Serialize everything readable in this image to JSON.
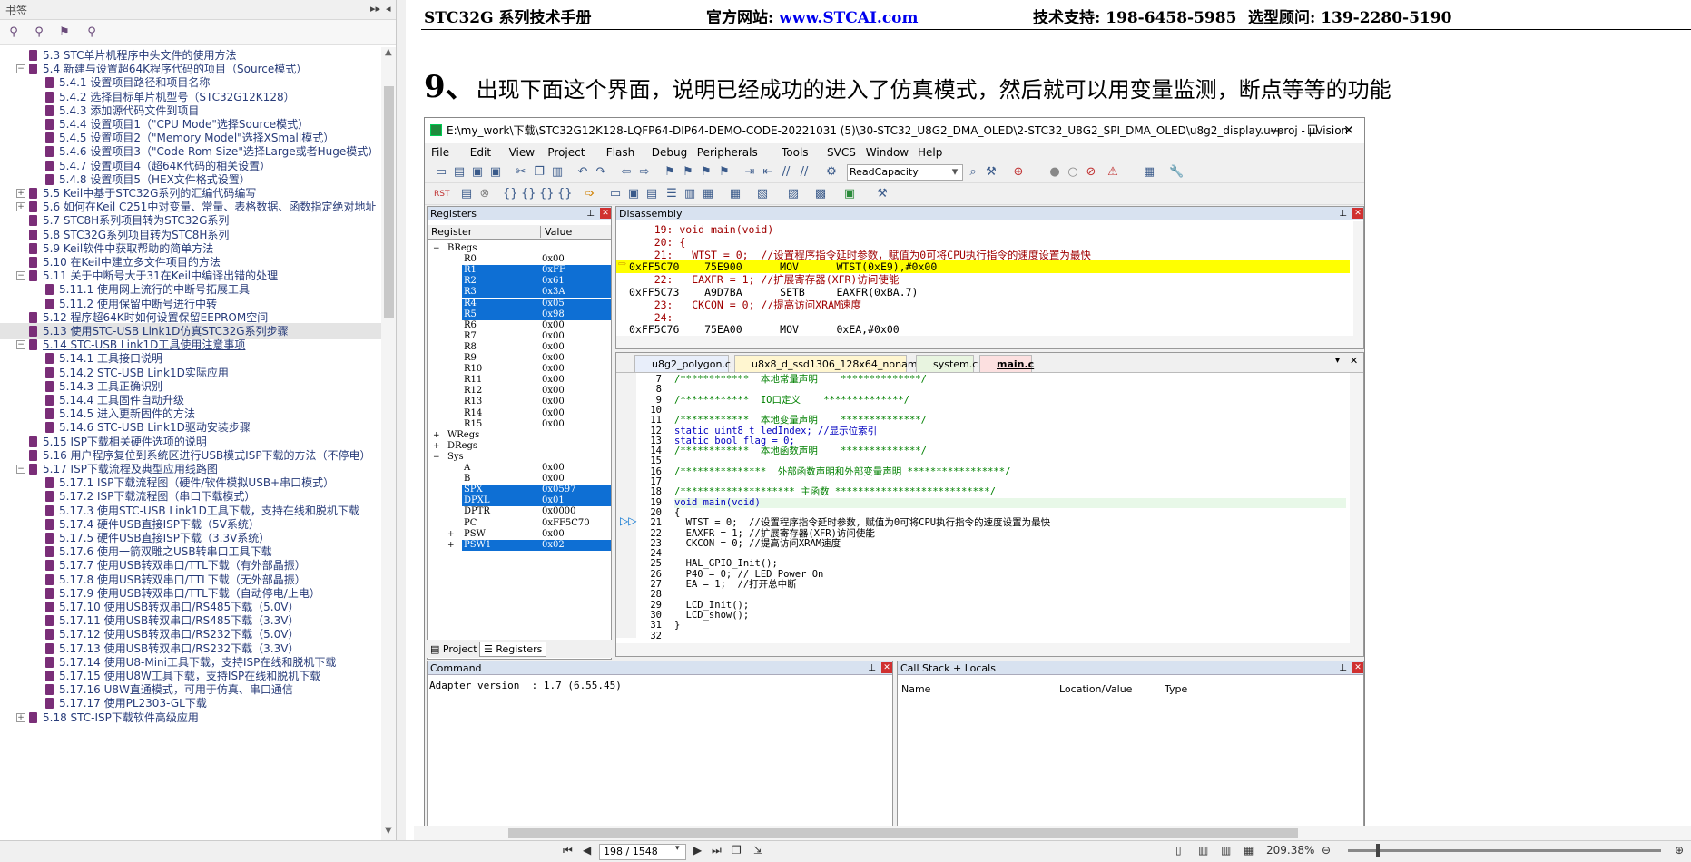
{
  "sidebar": {
    "title": "书签",
    "ctl_expand": "▸▸",
    "ctl_collapse": "◂",
    "items": [
      {
        "label": "5.3  STC单片机程序中头文件的使用方法",
        "lvl": 1,
        "exp": ""
      },
      {
        "label": "5.4  新建与设置超64K程序代码的项目（Source模式）",
        "lvl": 1,
        "exp": "−"
      },
      {
        "label": "5.4.1 设置项目路径和项目名称",
        "lvl": 2,
        "exp": ""
      },
      {
        "label": "5.4.2 选择目标单片机型号（STC32G12K128）",
        "lvl": 2,
        "exp": ""
      },
      {
        "label": "5.4.3 添加源代码文件到项目",
        "lvl": 2,
        "exp": ""
      },
      {
        "label": "5.4.4 设置项目1（\"CPU Mode\"选择Source模式）",
        "lvl": 2,
        "exp": ""
      },
      {
        "label": "5.4.5 设置项目2（\"Memory Model\"选择XSmall模式）",
        "lvl": 2,
        "exp": ""
      },
      {
        "label": "5.4.6  设置项目3（\"Code Rom Size\"选择Large或者Huge模式）",
        "lvl": 2,
        "exp": ""
      },
      {
        "label": "5.4.7  设置项目4（超64K代码的相关设置）",
        "lvl": 2,
        "exp": ""
      },
      {
        "label": "5.4.8  设置项目5（HEX文件格式设置）",
        "lvl": 2,
        "exp": ""
      },
      {
        "label": "5.5  Keil中基于STC32G系列的汇编代码编写",
        "lvl": 1,
        "exp": "+"
      },
      {
        "label": "5.6  如何在Keil C251中对变量、常量、表格数据、函数指定绝对地址",
        "lvl": 1,
        "exp": "+"
      },
      {
        "label": "5.7  STC8H系列项目转为STC32G系列",
        "lvl": 1,
        "exp": ""
      },
      {
        "label": "5.8  STC32G系列项目转为STC8H系列",
        "lvl": 1,
        "exp": ""
      },
      {
        "label": "5.9  Keil软件中获取帮助的简单方法",
        "lvl": 1,
        "exp": ""
      },
      {
        "label": "5.10  在Keil中建立多文件项目的方法",
        "lvl": 1,
        "exp": ""
      },
      {
        "label": "5.11  关于中断号大于31在Keil中编译出错的处理",
        "lvl": 1,
        "exp": "−"
      },
      {
        "label": "5.11.1 使用网上流行的中断号拓展工具",
        "lvl": 2,
        "exp": ""
      },
      {
        "label": "5.11.2  使用保留中断号进行中转",
        "lvl": 2,
        "exp": ""
      },
      {
        "label": "5.12  程序超64K时如何设置保留EEPROM空间",
        "lvl": 1,
        "exp": ""
      },
      {
        "label": "5.13  使用STC-USB Link1D仿真STC32G系列步骤",
        "lvl": 1,
        "exp": "",
        "sel": true
      },
      {
        "label": "5.14  STC-USB Link1D工具使用注意事项",
        "lvl": 1,
        "exp": "−",
        "ul": true
      },
      {
        "label": "5.14.1 工具接口说明",
        "lvl": 2,
        "exp": ""
      },
      {
        "label": "5.14.2  STC-USB Link1D实际应用",
        "lvl": 2,
        "exp": ""
      },
      {
        "label": "5.14.3  工具正确识别",
        "lvl": 2,
        "exp": ""
      },
      {
        "label": "5.14.4 工具固件自动升级",
        "lvl": 2,
        "exp": ""
      },
      {
        "label": "5.14.5 进入更新固件的方法",
        "lvl": 2,
        "exp": ""
      },
      {
        "label": "5.14.6  STC-USB Link1D驱动安装步骤",
        "lvl": 2,
        "exp": ""
      },
      {
        "label": "5.15  ISP下载相关硬件选项的说明",
        "lvl": 1,
        "exp": ""
      },
      {
        "label": "5.16  用户程序复位到系统区进行USB模式ISP下载的方法（不停电）",
        "lvl": 1,
        "exp": ""
      },
      {
        "label": "5.17  ISP下载流程及典型应用线路图",
        "lvl": 1,
        "exp": "−"
      },
      {
        "label": "5.17.1 ISP下载流程图（硬件/软件模拟USB+串口模式）",
        "lvl": 2,
        "exp": ""
      },
      {
        "label": "5.17.2  ISP下载流程图（串口下载模式）",
        "lvl": 2,
        "exp": ""
      },
      {
        "label": "5.17.3  使用STC-USB Link1D工具下载，支持在线和脱机下载",
        "lvl": 2,
        "exp": ""
      },
      {
        "label": "5.17.4  硬件USB直接ISP下载（5V系统）",
        "lvl": 2,
        "exp": ""
      },
      {
        "label": "5.17.5  硬件USB直接ISP下载（3.3V系统）",
        "lvl": 2,
        "exp": ""
      },
      {
        "label": "5.17.6  使用一箭双雕之USB转串口工具下载",
        "lvl": 2,
        "exp": ""
      },
      {
        "label": "5.17.7  使用USB转双串口/TTL下载（有外部晶振）",
        "lvl": 2,
        "exp": ""
      },
      {
        "label": "5.17.8  使用USB转双串口/TTL下载（无外部晶振）",
        "lvl": 2,
        "exp": ""
      },
      {
        "label": "5.17.9  使用USB转双串口/TTL下载（自动停电/上电）",
        "lvl": 2,
        "exp": ""
      },
      {
        "label": "5.17.10  使用USB转双串口/RS485下载（5.0V）",
        "lvl": 2,
        "exp": ""
      },
      {
        "label": "5.17.11 使用USB转双串口/RS485下载（3.3V）",
        "lvl": 2,
        "exp": ""
      },
      {
        "label": "5.17.12  使用USB转双串口/RS232下载（5.0V）",
        "lvl": 2,
        "exp": ""
      },
      {
        "label": "5.17.13  使用USB转双串口/RS232下载（3.3V）",
        "lvl": 2,
        "exp": ""
      },
      {
        "label": "5.17.14  使用U8-Mini工具下载，支持ISP在线和脱机下载",
        "lvl": 2,
        "exp": ""
      },
      {
        "label": "5.17.15  使用U8W工具下载，支持ISP在线和脱机下载",
        "lvl": 2,
        "exp": ""
      },
      {
        "label": "5.17.16  U8W直通模式，可用于仿真、串口通信",
        "lvl": 2,
        "exp": ""
      },
      {
        "label": "5.17.17  使用PL2303-GL下载",
        "lvl": 2,
        "exp": ""
      },
      {
        "label": "5.18  STC-ISP下载软件高级应用",
        "lvl": 1,
        "exp": "+"
      }
    ]
  },
  "page": {
    "hdr_title": "STC32G 系列技术手册",
    "hdr_site_label": "官方网站: ",
    "hdr_site_url": "www.STCAI.com",
    "hdr_support": "技术支持: 198-6458-5985",
    "hdr_sales": "选型顾问: 139-2280-5190",
    "step_num": "9、",
    "step_text": "出现下面这个界面，说明已经成功的进入了仿真模式，然后就可以用变量监测，断点等等的功能"
  },
  "uvision": {
    "title": "E:\\my_work\\下载\\STC32G12K128-LQFP64-DIP64-DEMO-CODE-20221031 (5)\\30-STC32_U8G2_DMA_OLED\\2-STC32_U8G2_SPI_DMA_OLED\\u8g2_display.uvproj - µVision",
    "menus": [
      "File",
      "Edit",
      "View",
      "Project",
      "Flash",
      "Debug",
      "Peripherals",
      "Tools",
      "SVCS",
      "Window",
      "Help"
    ],
    "target_combo": "ReadCapacity",
    "registers": {
      "title": "Registers",
      "col_reg": "Register",
      "col_val": "Value",
      "rows": [
        {
          "n": "BRegs",
          "v": "",
          "grp": true,
          "exp": "−"
        },
        {
          "n": "R0",
          "v": "0x00"
        },
        {
          "n": "R1",
          "v": "0xFF",
          "hl": true
        },
        {
          "n": "R2",
          "v": "0x61",
          "hl": true
        },
        {
          "n": "R3",
          "v": "0x3A",
          "hl": true
        },
        {
          "n": "R4",
          "v": "0x05",
          "hl": true
        },
        {
          "n": "R5",
          "v": "0x98",
          "hl": true
        },
        {
          "n": "R6",
          "v": "0x00"
        },
        {
          "n": "R7",
          "v": "0x00"
        },
        {
          "n": "R8",
          "v": "0x00"
        },
        {
          "n": "R9",
          "v": "0x00"
        },
        {
          "n": "R10",
          "v": "0x00"
        },
        {
          "n": "R11",
          "v": "0x00"
        },
        {
          "n": "R12",
          "v": "0x00"
        },
        {
          "n": "R13",
          "v": "0x00"
        },
        {
          "n": "R14",
          "v": "0x00"
        },
        {
          "n": "R15",
          "v": "0x00"
        },
        {
          "n": "WRegs",
          "v": "",
          "grp": true,
          "exp": "+"
        },
        {
          "n": "DRegs",
          "v": "",
          "grp": true,
          "exp": "+"
        },
        {
          "n": "Sys",
          "v": "",
          "grp": true,
          "exp": "−"
        },
        {
          "n": "A",
          "v": "0x00"
        },
        {
          "n": "B",
          "v": "0x00"
        },
        {
          "n": "SPX",
          "v": "0x0597",
          "hl": true
        },
        {
          "n": "DPXL",
          "v": "0x01",
          "hl": true
        },
        {
          "n": "DPTR",
          "v": "0x0000"
        },
        {
          "n": "PC",
          "v": "0xFF5C70"
        },
        {
          "n": "PSW",
          "v": "0x00",
          "exp": "+"
        },
        {
          "n": "PSW1",
          "v": "0x02",
          "hl": true,
          "exp": "+"
        }
      ],
      "tab_project": "Project",
      "tab_registers": "Registers"
    },
    "disasm": {
      "title": "Disassembly",
      "lines": [
        {
          "t": "    19: void main(void)",
          "k": "src"
        },
        {
          "t": "    20: {",
          "k": "src"
        },
        {
          "t": "    21:   WTST = 0;  //设置程序指令延时参数，赋值为0可将CPU执行指令的速度设置为最快",
          "k": "src"
        },
        {
          "t": "0xFF5C70    75E900      MOV      WTST(0xE9),#0x00",
          "k": "cur"
        },
        {
          "t": "    22:   EAXFR = 1; //扩展寄存器(XFR)访问使能",
          "k": "src"
        },
        {
          "t": "0xFF5C73    A9D7BA      SETB     EAXFR(0xBA.7)",
          "k": "asm"
        },
        {
          "t": "    23:   CKCON = 0; //提高访问XRAM速度",
          "k": "src"
        },
        {
          "t": "    24:",
          "k": "src"
        },
        {
          "t": "0xFF5C76    75EA00      MOV      0xEA,#0x00",
          "k": "asm"
        }
      ]
    },
    "editor": {
      "tabs": [
        "u8g2_polygon.c",
        "u8x8_d_ssd1306_128x64_noname.c",
        "system.c",
        "main.c"
      ],
      "lines": [
        {
          "n": "7",
          "t": "/************  本地常量声明    **************/",
          "c": "#008000"
        },
        {
          "n": "8",
          "t": "",
          "c": "#000"
        },
        {
          "n": "9",
          "t": "/************  IO口定义    **************/",
          "c": "#008000"
        },
        {
          "n": "10",
          "t": "",
          "c": "#000"
        },
        {
          "n": "11",
          "t": "/************  本地变量声明    **************/",
          "c": "#008000"
        },
        {
          "n": "12",
          "t": "static uint8_t ledIndex; //显示位索引",
          "c": "#0000c0"
        },
        {
          "n": "13",
          "t": "static bool flag = 0;",
          "c": "#0000c0"
        },
        {
          "n": "14",
          "t": "/************  本地函数声明    **************/",
          "c": "#008000"
        },
        {
          "n": "15",
          "t": "",
          "c": "#000"
        },
        {
          "n": "16",
          "t": "/***************  外部函数声明和外部变量声明 *****************/",
          "c": "#008000"
        },
        {
          "n": "17",
          "t": "",
          "c": "#000"
        },
        {
          "n": "18",
          "t": "/******************** 主函数 ***************************/",
          "c": "#008000"
        },
        {
          "n": "19",
          "t": "void main(void)",
          "c": "#0000c0"
        },
        {
          "n": "20",
          "t": "{",
          "c": "#000"
        },
        {
          "n": "21",
          "t": "  WTST = 0;  //设置程序指令延时参数，赋值为0可将CPU执行指令的速度设置为最快",
          "c": "#000"
        },
        {
          "n": "22",
          "t": "  EAXFR = 1; //扩展寄存器(XFR)访问使能",
          "c": "#000"
        },
        {
          "n": "23",
          "t": "  CKCON = 0; //提高访问XRAM速度",
          "c": "#000"
        },
        {
          "n": "24",
          "t": "",
          "c": "#000"
        },
        {
          "n": "25",
          "t": "  HAL_GPIO_Init();",
          "c": "#000"
        },
        {
          "n": "26",
          "t": "  P40 = 0; // LED Power On",
          "c": "#000"
        },
        {
          "n": "27",
          "t": "  EA = 1;  //打开总中断",
          "c": "#000"
        },
        {
          "n": "28",
          "t": "",
          "c": "#000"
        },
        {
          "n": "29",
          "t": "  LCD_Init();",
          "c": "#000"
        },
        {
          "n": "30",
          "t": "  LCD_show();",
          "c": "#000"
        },
        {
          "n": "31",
          "t": "}",
          "c": "#000"
        },
        {
          "n": "32",
          "t": "",
          "c": "#000"
        }
      ]
    },
    "command": {
      "title": "Command",
      "line": "Adapter version  : 1.7 (6.55.45)"
    },
    "callstack": {
      "title": "Call Stack + Locals",
      "col_name": "Name",
      "col_loc": "Location/Value",
      "col_type": "Type"
    }
  },
  "status": {
    "page_indicator": "198 / 1548",
    "zoom": "209.38%"
  }
}
